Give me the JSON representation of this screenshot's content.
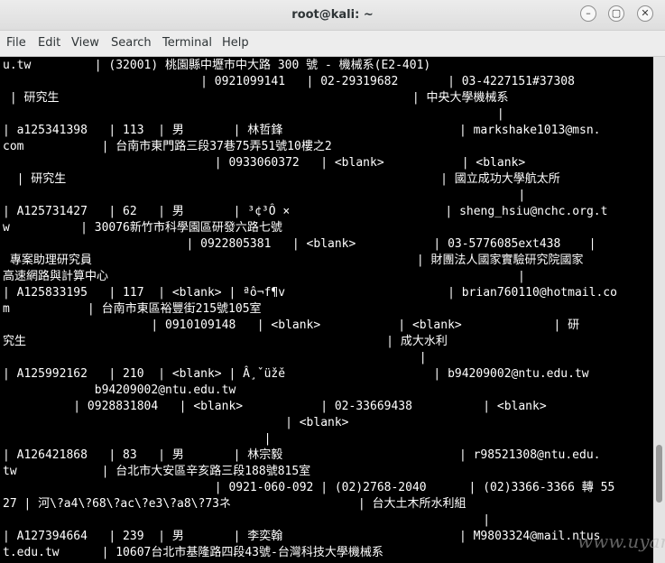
{
  "window": {
    "title": "root@kali: ~"
  },
  "titlebar": {
    "minimize_glyph": "–",
    "maximize_glyph": "▢",
    "close_glyph": "✕"
  },
  "menu": [
    "File",
    "Edit",
    "View",
    "Search",
    "Terminal",
    "Help"
  ],
  "terminal": {
    "lines": [
      "u.tw         | (32001) 桃園縣中壢市中大路 300 號 - 機械系(E2-401)",
      "                            | 0921099141   | 02-29319682       | 03-4227151#37308",
      " | 研究生                                                  | 中央大學機械系",
      "                                                                      |",
      "| a125341398   | 113  | 男       | 林哲鋒                         | markshake1013@msn.",
      "com           | 台南市東門路三段37巷75弄51號10樓之2",
      "                              | 0933060372   | <blank>           | <blank>",
      "  | 研究生                                                     | 國立成功大學航太所",
      "                                                                         |",
      "| A125731427   | 62   | 男       | ³¢³Ô ×                      | sheng_hsiu@nchc.org.t",
      "w          | 30076新竹市科學園區研發六路七號",
      "                          | 0922805381   | <blank>           | 03-5776085ext438    |",
      " 專案助理研究員                                              | 財團法人國家實驗研究院國家",
      "高速網路與計算中心                                                          |",
      "| A125833195   | 117  | <blank> | ªô¬f¶v                       | brian760110@hotmail.co",
      "m           | 台南市東區裕豐街215號105室",
      "                     | 0910109148   | <blank>           | <blank>             | 研",
      "究生                                                   | 成大水利",
      "                                                           |",
      "| A125992162   | 210  | <blank> | Â¸ˇüžě                     | b94209002@ntu.edu.tw",
      "             b94209002@ntu.edu.tw",
      "          | 0928831804   | <blank>           | 02-33669438          | <blank>",
      "                                        | <blank>",
      "                                     |",
      "| A126421868   | 83   | 男       | 林宗毅                         | r98521308@ntu.edu.",
      "tw            | 台北市大安區辛亥路三段188號815室",
      "                              | 0921-060-092 | (02)2768-2040      | (02)3366-3366 轉 55",
      "27 | 河\\?a4\\?68\\?ac\\?e3\\?a8\\?73ネ                  | 台大土木所水利組",
      "                                                                    |",
      "| A127394664   | 239  | 男       | 李奕翰                         | M9803324@mail.ntus",
      "t.edu.tw      | 10607台北市基隆路四段43號-台灣科技大學機械系"
    ]
  },
  "watermark": "www.uyan.org"
}
